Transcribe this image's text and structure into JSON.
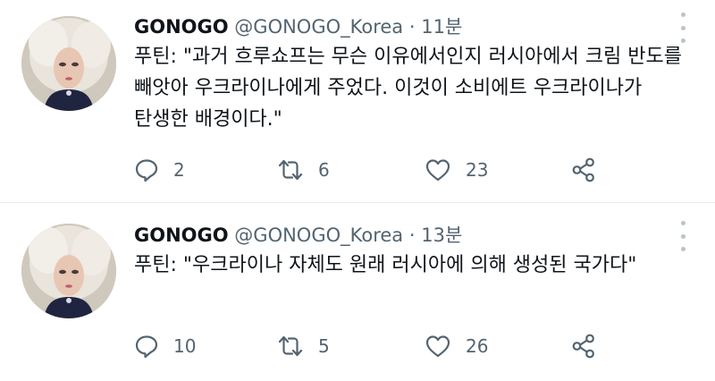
{
  "tweets": [
    {
      "name": "GONOGO",
      "handle": "@GONOGO_Korea",
      "separator": "·",
      "time": "11분",
      "text": "푸틴: \"과거 흐루쇼프는 무슨 이유에서인지 러시아에서 크림 반도를 빼앗아 우크라이나에게 주었다.  이것이 소비에트 우크라이나가 탄생한 배경이다.\"",
      "replies": "2",
      "retweets": "6",
      "likes": "23"
    },
    {
      "name": "GONOGO",
      "handle": "@GONOGO_Korea",
      "separator": "·",
      "time": "13분",
      "text": "푸틴: \"우크라이나 자체도 원래 러시아에 의해 생성된 국가다\"",
      "replies": "10",
      "retweets": "5",
      "likes": "26"
    }
  ],
  "icons": {
    "reply": "reply-icon",
    "retweet": "retweet-icon",
    "like": "heart-icon",
    "share": "share-icon",
    "more": "more-icon"
  },
  "colors": {
    "text": "#0f1419",
    "secondary": "#536471",
    "divider": "#e6ecf0"
  }
}
